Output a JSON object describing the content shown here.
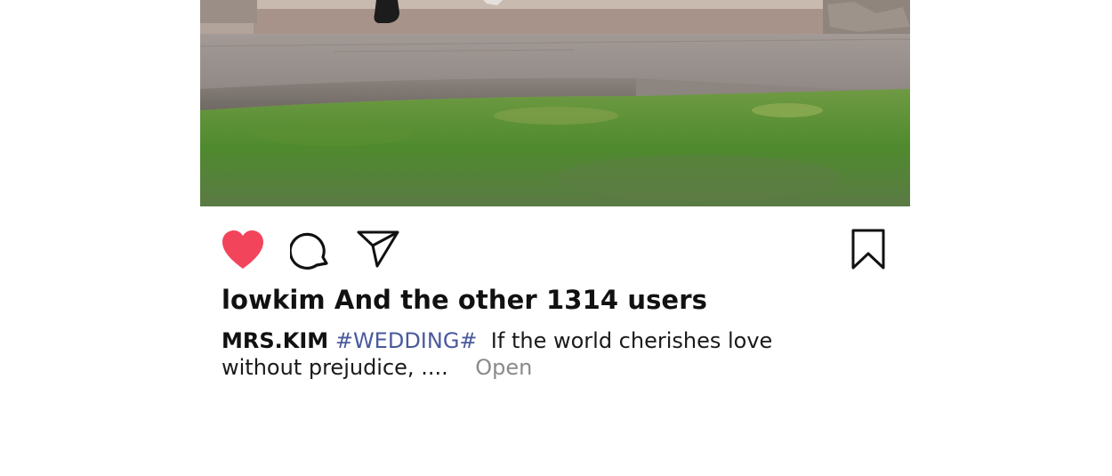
{
  "post": {
    "likes_text": "lowkim And the other 1314 users",
    "caption": {
      "author": "MRS.KIM",
      "hashtag": "#WEDDING#",
      "text": "If the world cherishes love without prejudice, ....",
      "more_label": "Open"
    }
  },
  "actions": {
    "like": {
      "icon": "heart-icon",
      "state": "liked",
      "color": "#f2445b"
    },
    "comment": {
      "icon": "comment-bubble-icon"
    },
    "share": {
      "icon": "send-icon"
    },
    "save": {
      "icon": "bookmark-icon"
    }
  },
  "colors": {
    "hashtag": "#4a5a9c",
    "more_link": "#8a8a8a",
    "like_active": "#f2445b"
  }
}
